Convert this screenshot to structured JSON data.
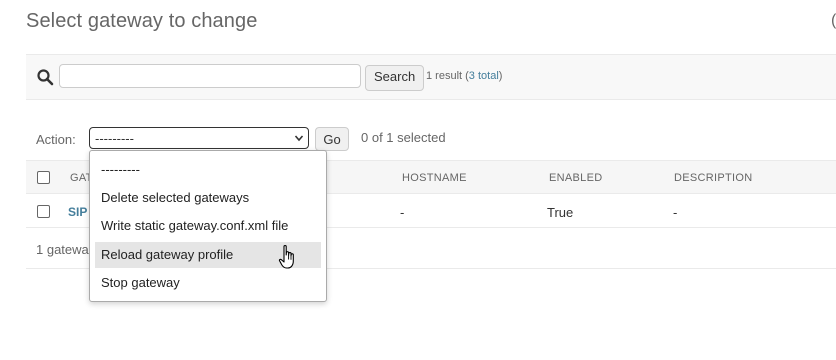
{
  "page": {
    "title": "Select gateway to change"
  },
  "search": {
    "button_label": "Search",
    "result_text": "1 result (",
    "total_link": "3 total",
    "result_suffix": ")",
    "placeholder": ""
  },
  "actions": {
    "label": "Action:",
    "selected_value": "---------",
    "go_label": "Go",
    "selected_count": "0 of 1 selected",
    "options": [
      "---------",
      "Delete selected gateways",
      "Write static gateway.conf.xml file",
      "Reload gateway profile",
      "Stop gateway"
    ],
    "hovered_option": "Reload gateway profile"
  },
  "table": {
    "columns": [
      "GATEWAY",
      "HOSTNAME",
      "ENABLED",
      "DESCRIPTION"
    ],
    "visible_first_column_header": "GAT",
    "rows": [
      {
        "name_visible": "SIP",
        "hostname": "-",
        "enabled": "True",
        "description": "-"
      }
    ]
  },
  "footer": {
    "count_visible": "1 gatewa"
  },
  "icons": {
    "search": "search-icon",
    "chevron": "chevron-down-icon",
    "cursor": "hand-pointer-icon"
  },
  "colors": {
    "link": "#447e9b",
    "toolbar_bg": "#f8f8f8",
    "hover_bg": "#e5e5e5"
  }
}
